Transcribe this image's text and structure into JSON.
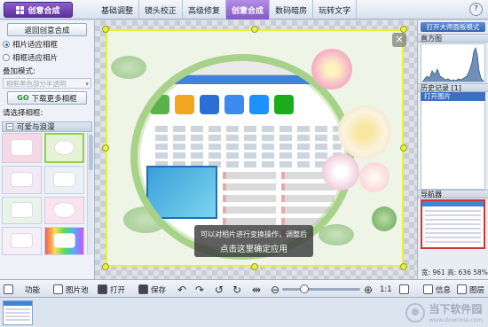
{
  "top": {
    "main_button": "创意合成",
    "tabs": [
      "基础调整",
      "镜头校正",
      "高级修复",
      "创意合成",
      "数码暗房",
      "玩转文字"
    ],
    "active_tab": "创意合成",
    "help": "?"
  },
  "left": {
    "back_button": "返回创意合成",
    "fit_photo": "相片适应相框",
    "fit_frame": "相框适应相片",
    "overlay_mode_label": "叠加模式:",
    "overlay_mode_value": "相框黑色部分半透明",
    "download_prefix": "GO",
    "download_label": "下载更多相框",
    "choose_label": "请选择相框:",
    "category": "可爱与浪漫"
  },
  "canvas": {
    "close": "×",
    "tooltip_line1": "可以对相片进行变换操作，调整后",
    "tooltip_line2": "点击这里确定应用"
  },
  "right": {
    "master_mode": "打开大师面板模式",
    "histogram": "直方图",
    "history": "历史记录 [1]",
    "history_item": "打开图片",
    "navigator": "导航器",
    "info": "宽: 961 高: 636 58%"
  },
  "bottom": {
    "func": "功能",
    "film": "图片池",
    "open": "打开",
    "save": "保存",
    "ratio": "1:1",
    "info": "信息",
    "layer": "图层"
  },
  "watermark": {
    "name": "当下软件园",
    "url": "www.downxia.com"
  }
}
